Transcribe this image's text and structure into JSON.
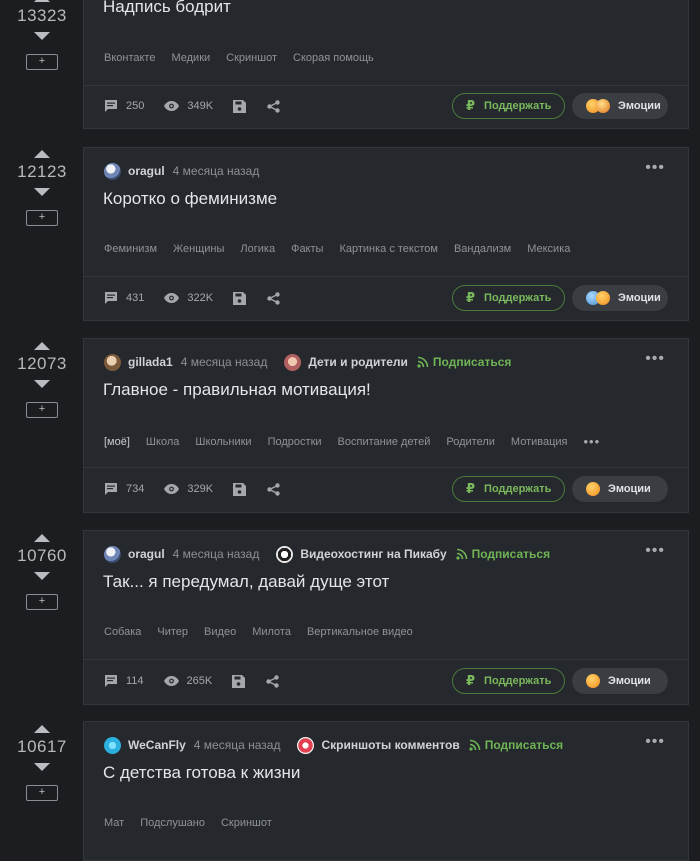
{
  "posts": [
    {
      "score": "13323",
      "plus": "+",
      "author": "",
      "time": "",
      "community": "",
      "subscribe": "",
      "title": "Надпись бодрит",
      "tags": [
        "Вконтакте",
        "Медики",
        "Скриншот",
        "Скорая помощь"
      ],
      "comments": "250",
      "views": "349K",
      "support": "Поддержать",
      "emotions": "Эмоции",
      "emoji_count": 2
    },
    {
      "score": "12123",
      "plus": "+",
      "author": "oragul",
      "time": "4 месяца назад",
      "community": "",
      "subscribe": "",
      "title": "Коротко о феминизме",
      "tags": [
        "Феминизм",
        "Женщины",
        "Логика",
        "Факты",
        "Картинка с текстом",
        "Вандализм",
        "Мексика"
      ],
      "comments": "431",
      "views": "322K",
      "support": "Поддержать",
      "emotions": "Эмоции",
      "emoji_count": 2
    },
    {
      "score": "12073",
      "plus": "+",
      "author": "gillada1",
      "time": "4 месяца назад",
      "community": "Дети и родители",
      "subscribe": "Подписаться",
      "title": "Главное - правильная мотивация!",
      "tags": [
        "[моё]",
        "Школа",
        "Школьники",
        "Подростки",
        "Воспитание детей",
        "Родители",
        "Мотивация"
      ],
      "tags_more": "•••",
      "comments": "734",
      "views": "329K",
      "support": "Поддержать",
      "emotions": "Эмоции",
      "emoji_count": 1
    },
    {
      "score": "10760",
      "plus": "+",
      "author": "oragul",
      "time": "4 месяца назад",
      "community": "Видеохостинг на Пикабу",
      "subscribe": "Подписаться",
      "title": "Так... я передумал, давай дуще этот",
      "tags": [
        "Собака",
        "Читер",
        "Видео",
        "Милота",
        "Вертикальное видео"
      ],
      "comments": "114",
      "views": "265K",
      "support": "Поддержать",
      "emotions": "Эмоции",
      "emoji_count": 1
    },
    {
      "score": "10617",
      "plus": "+",
      "author": "WeCanFly",
      "time": "4 месяца назад",
      "community": "Скриншоты комментов",
      "subscribe": "Подписаться",
      "title": "С детства готова к жизни",
      "tags": [
        "Мат",
        "Подслушано",
        "Скриншот"
      ]
    }
  ],
  "icons": {
    "comments": "comment-icon",
    "views": "eye-icon",
    "save": "save-icon",
    "share": "share-icon",
    "subscribe": "rss-icon",
    "more": "more-dots-icon"
  },
  "colors": {
    "background": "#1b1d20",
    "card": "#25282c",
    "accent_green": "#6fb556"
  }
}
